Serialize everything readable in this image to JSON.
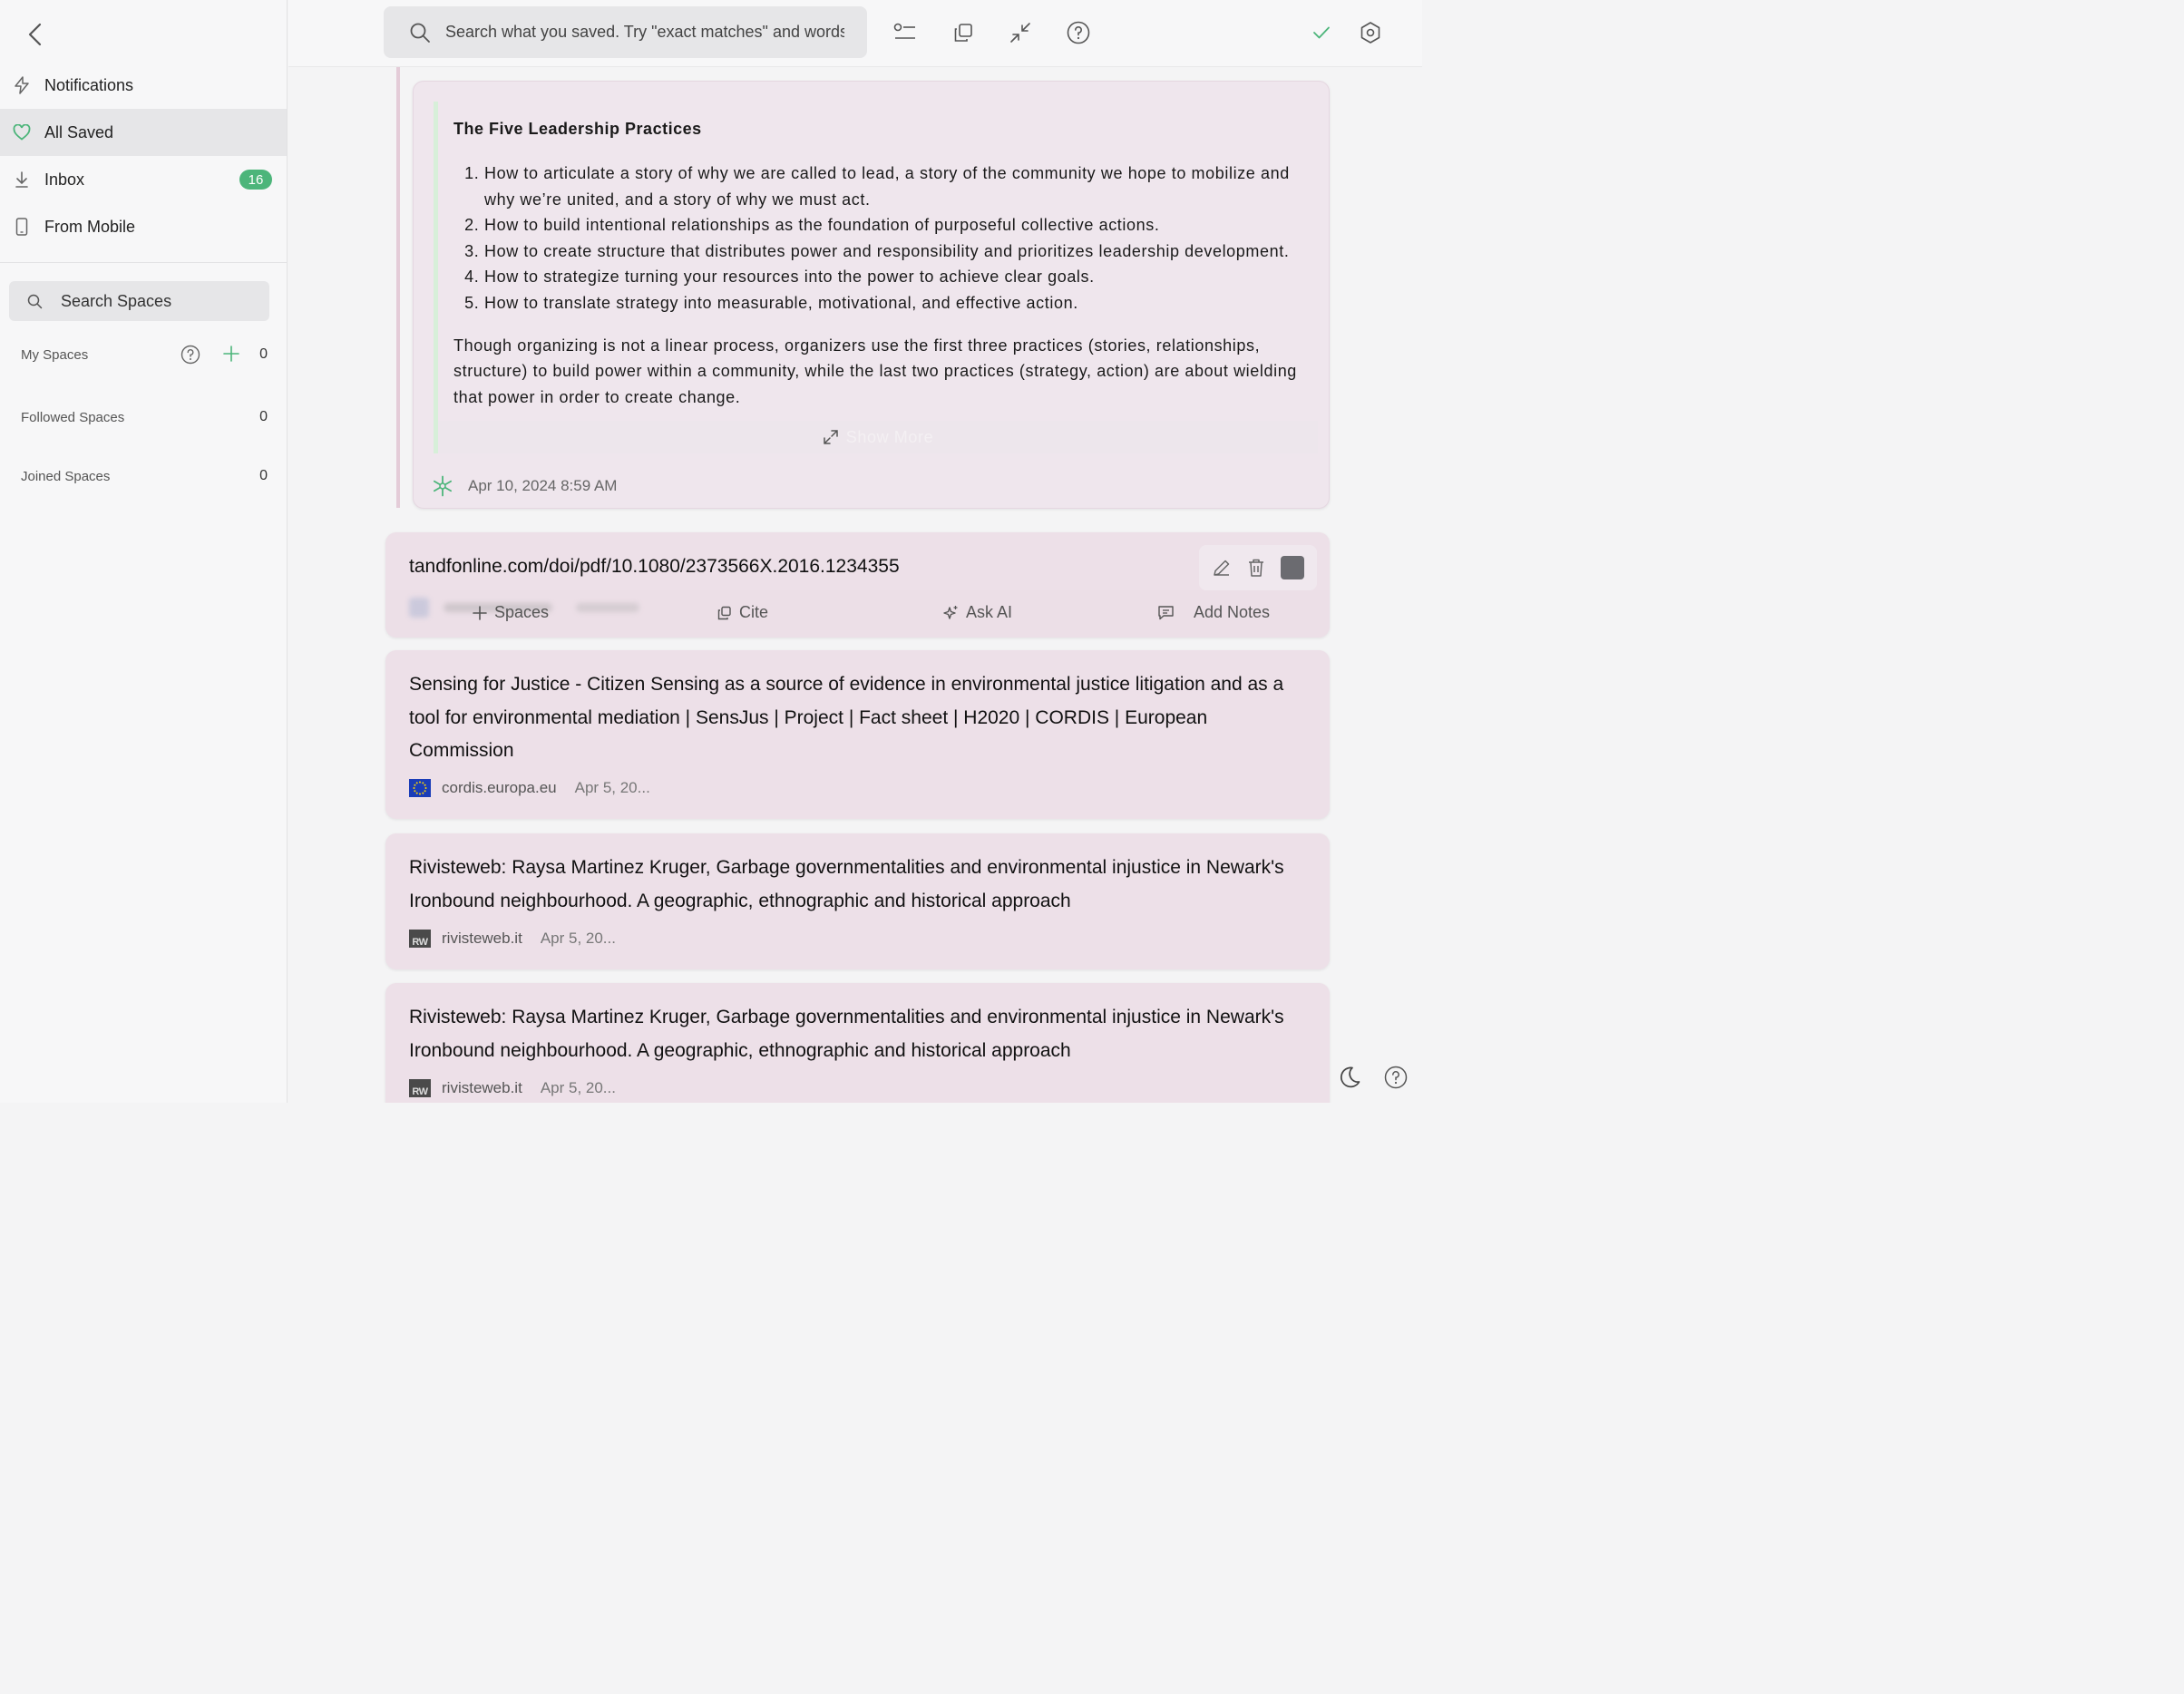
{
  "sidebar": {
    "nav": [
      {
        "label": "Notifications",
        "icon": "bolt-icon"
      },
      {
        "label": "All Saved",
        "icon": "heart-icon"
      },
      {
        "label": "Inbox",
        "icon": "download-icon",
        "badge": "16"
      },
      {
        "label": "From Mobile",
        "icon": "phone-icon"
      }
    ],
    "search_placeholder": "Search Spaces",
    "sections": [
      {
        "label": "My Spaces",
        "count": "0"
      },
      {
        "label": "Followed Spaces",
        "count": "0"
      },
      {
        "label": "Joined Spaces",
        "count": "0"
      }
    ]
  },
  "topbar": {
    "search_placeholder": "Search what you saved. Try \"exact matches\" and words!"
  },
  "note": {
    "heading": "The Five Leadership Practices",
    "items": [
      "How to articulate a story of why we are called to lead, a story of the community we hope to mobilize and why we’re united, and a story of why we must act.",
      "How to build intentional relationships as the foundation of purposeful collective actions.",
      "How to create structure that distributes power and responsibility and prioritizes leadership development.",
      "How to strategize turning your resources into the power to achieve clear goals.",
      "How to translate strategy into measurable, motivational, and effective action."
    ],
    "paragraph": "Though organizing is not a linear process, organizers use the first three practices (stories, relationships, structure) to build power within a community, while the last two practices (strategy, action) are about wielding that power in order to create change.",
    "show_more": "Show More",
    "timestamp": "Apr 10, 2024 8:59 AM"
  },
  "link_card": {
    "title": "tandfonline.com/doi/pdf/10.1080/2373566X.2016.1234355",
    "actions": [
      "Spaces",
      "Cite",
      "Ask AI",
      "Add Notes"
    ]
  },
  "results": [
    {
      "title": "Sensing for Justice - Citizen Sensing as a source of evidence in environmental justice litigation and as a tool for environmental mediation | SensJus | Project | Fact sheet | H2020 | CORDIS | European Commission",
      "domain": "cordis.europa.eu",
      "date": "Apr 5, 20..."
    },
    {
      "title": "Rivisteweb: Raysa Martinez Kruger, Garbage governmentalities and environmental injustice in Newark's Ironbound neighbourhood. A geographic, ethnographic and historical approach",
      "domain": "rivisteweb.it",
      "date": "Apr 5, 20...",
      "favicon_text": "RW"
    },
    {
      "title": "Rivisteweb: Raysa Martinez Kruger, Garbage governmentalities and environmental injustice in Newark's Ironbound neighbourhood. A geographic, ethnographic and historical approach",
      "domain": "rivisteweb.it",
      "date": "Apr 5, 20...",
      "favicon_text": "RW"
    }
  ],
  "colors": {
    "accent": "#4cb57a",
    "card": "#ede0e8",
    "sidebar": "#f7f7f8"
  }
}
